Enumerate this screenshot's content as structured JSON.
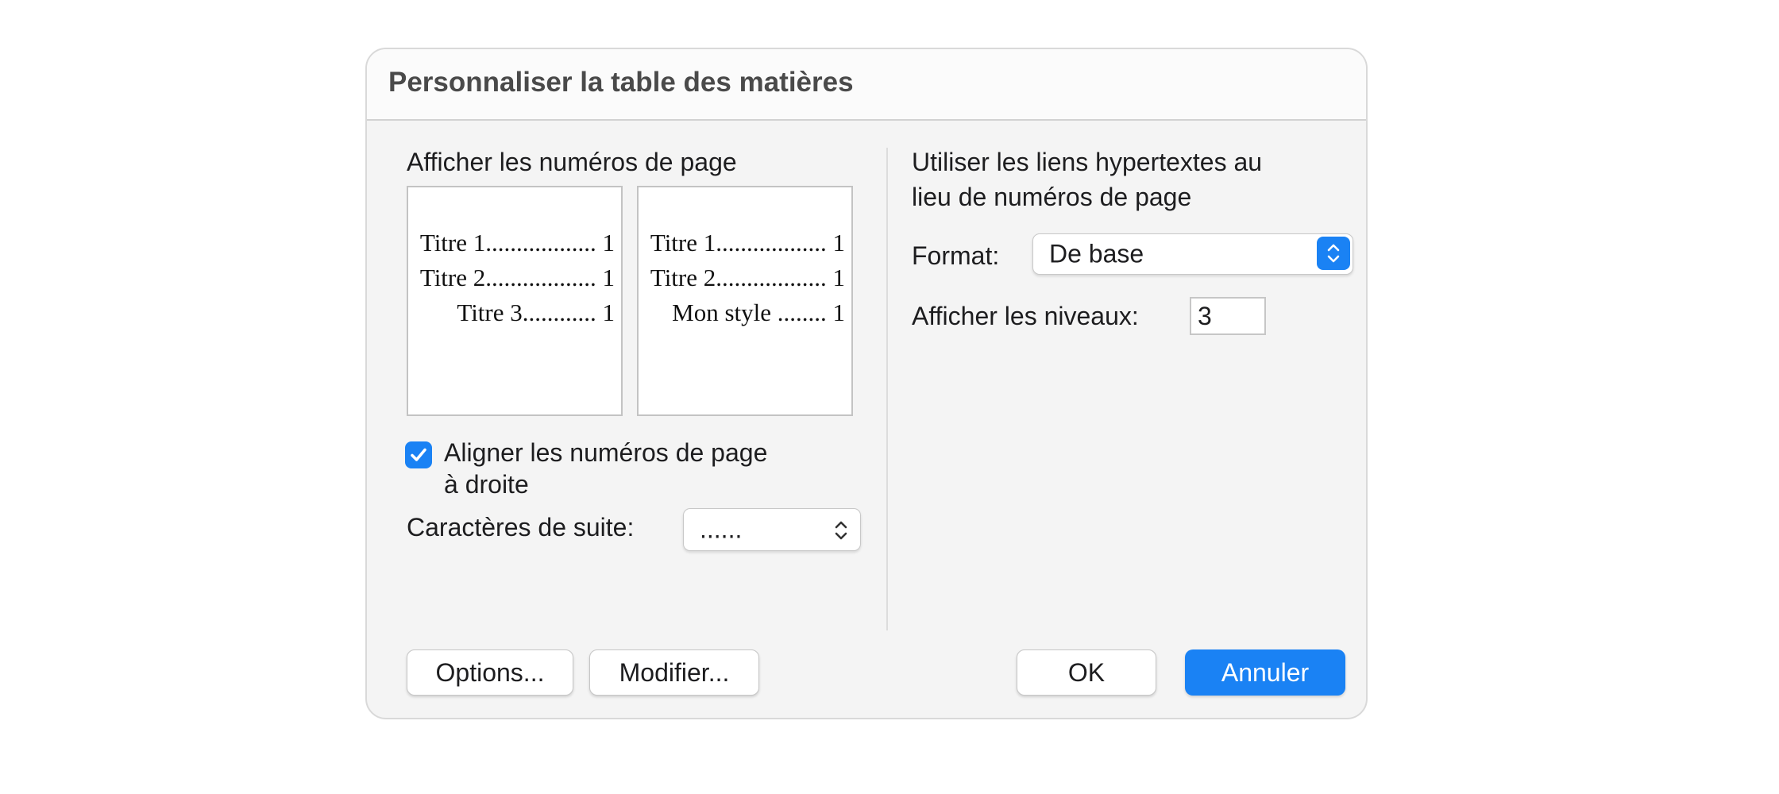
{
  "dialog": {
    "title": "Personnaliser la table des matières"
  },
  "left": {
    "show_page_numbers_label": "Afficher les numéros de page",
    "preview_print": {
      "lines": [
        "Titre 1.................. 1",
        "Titre 2.................. 1",
        "Titre 3............ 1"
      ]
    },
    "preview_web": {
      "lines": [
        "Titre 1.................. 1",
        "Titre 2.................. 1",
        "Mon style ........ 1"
      ]
    },
    "align_checkbox": {
      "checked": true,
      "label_line1": "Aligner les numéros de page",
      "label_line2": "à droite"
    },
    "leader": {
      "label": "Caractères de suite:",
      "value": "......"
    }
  },
  "right": {
    "hyperlinks_label_line1": "Utiliser les liens hypertextes au",
    "hyperlinks_label_line2": "lieu de numéros de page",
    "format": {
      "label": "Format:",
      "value": "De base"
    },
    "levels": {
      "label": "Afficher les niveaux:",
      "value": "3"
    }
  },
  "buttons": {
    "options": "Options...",
    "modify": "Modifier...",
    "ok": "OK",
    "cancel": "Annuler"
  },
  "colors": {
    "accent": "#1a82f4",
    "dialog_background": "#f4f4f4",
    "title_text": "#4a4a4a"
  },
  "icons": {
    "checkmark": "checkmark-icon",
    "popup_chevrons": "chevron-up-down-icon"
  }
}
